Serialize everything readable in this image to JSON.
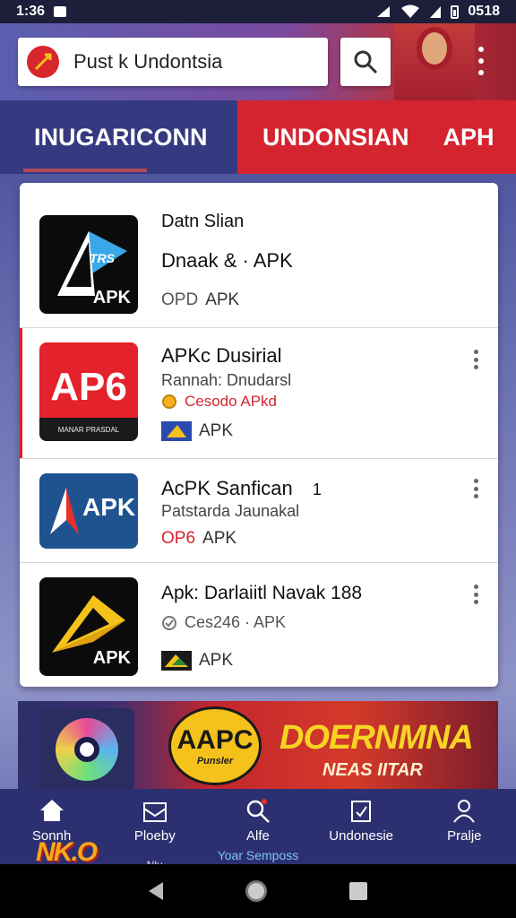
{
  "status_bar": {
    "time": "1:36",
    "right_time": "0518"
  },
  "header": {
    "search_query": "Pust k Undontsia",
    "search_icon": "search-icon",
    "menu_icon": "more-vert-icon"
  },
  "tabs": [
    {
      "label": "INUGARICONN"
    },
    {
      "label": "UNDONSIAN"
    },
    {
      "label": "APH"
    }
  ],
  "apps": [
    {
      "title": "Datn Slian",
      "subtitle": "Dnaak  & · APK",
      "meta_code": "OPD",
      "meta_label": "APK",
      "thumb_text": "APK",
      "thumb_badge": "TRS"
    },
    {
      "title": "APKc Dusirial",
      "subtitle": "Rannah: Dnudarsl",
      "rating": "Cesodo APkd",
      "meta_label": "APK",
      "thumb_text": "AP6",
      "thumb_caption": "MANAR PRASDAL"
    },
    {
      "title": "AcPK Sanfican",
      "title_suffix": "1",
      "subtitle": "Patstarda Jaunakal",
      "meta_code": "OP6",
      "meta_label": "APK",
      "thumb_text": "APK"
    },
    {
      "title": "Apk: Darlaiitl Navak 188",
      "subtitle": "Ces246 · APK",
      "meta_label": "APK",
      "thumb_text": "APK"
    }
  ],
  "banner": {
    "badge_text": "AAPC",
    "badge_sub": "Punsler",
    "headline": "DOERNMNA",
    "subline": "NEAS IITAR"
  },
  "bottom_nav": [
    {
      "label": "Sonnh",
      "icon": "home-icon"
    },
    {
      "label": "Ploeby",
      "extra": "Nlu",
      "icon": "inbox-icon"
    },
    {
      "label": "Alfe",
      "extra": "Yoar Semposs",
      "icon": "search-icon"
    },
    {
      "label": "Undonesie",
      "icon": "clipboard-icon"
    },
    {
      "label": "Pralje",
      "icon": "profile-icon"
    }
  ],
  "brand_mark": "NK.O",
  "colors": {
    "accent_red": "#d42430",
    "nav_blue": "#2d3070",
    "tab_blue": "#353980"
  }
}
